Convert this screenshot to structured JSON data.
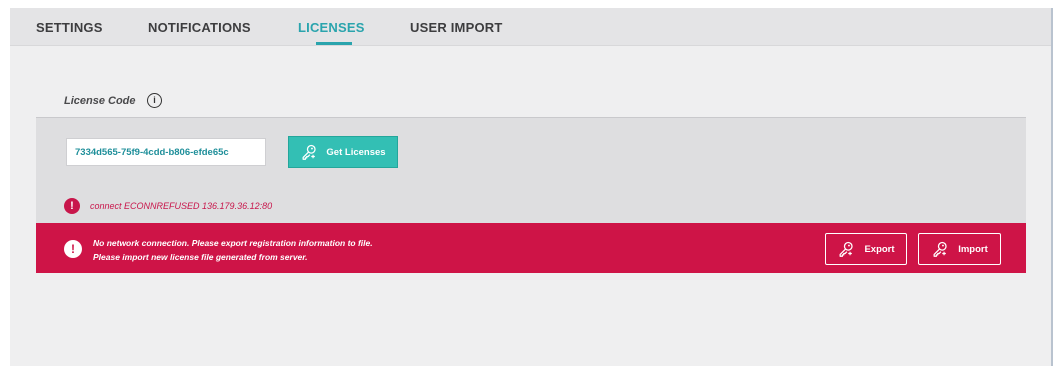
{
  "tabs": [
    {
      "label": "SETTINGS",
      "active": false
    },
    {
      "label": "NOTIFICATIONS",
      "active": false
    },
    {
      "label": "LICENSES",
      "active": true
    },
    {
      "label": "USER IMPORT",
      "active": false
    }
  ],
  "license": {
    "section_label": "License Code",
    "info_icon_glyph": "i",
    "code_value": "7334d565-75f9-4cdd-b806-efde65c",
    "get_button_label": "Get Licenses",
    "button_icon": "key-icon",
    "error_glyph": "!",
    "error_text": "connect ECONNREFUSED 136.179.36.12:80"
  },
  "alert": {
    "glyph": "!",
    "line1": "No network connection. Please export registration information to file.",
    "line2": "Please import new license file generated from server.",
    "export_label": "Export",
    "import_label": "Import"
  },
  "colors": {
    "accent": "#2aa4ad",
    "button_teal": "#33bfb4",
    "error_red": "#ce1447"
  }
}
